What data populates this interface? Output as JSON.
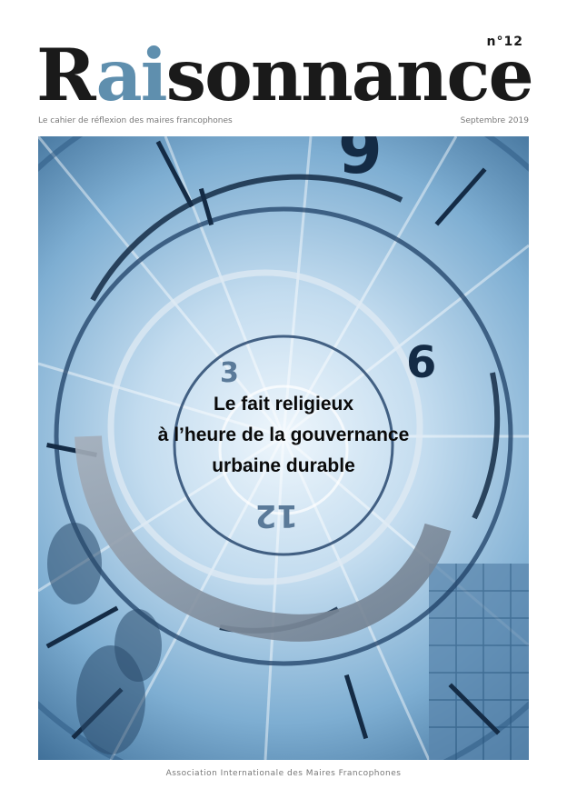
{
  "issue": {
    "label": "n°12"
  },
  "masthead": {
    "part1": "R",
    "accent": "ai",
    "part2": "sonnance"
  },
  "tagline": "Le cahier de réflexion des maires francophones",
  "date": "Septembre 2019",
  "headline": {
    "line1": "Le fait religieux",
    "line2": "à l’heure de la gouvernance",
    "line3": "urbaine durable"
  },
  "clock_numerals": [
    "9",
    "6",
    "3",
    "12"
  ],
  "footer": "Association Internationale des Maires Francophones",
  "colors": {
    "masthead_dark": "#1a1a1a",
    "masthead_accent": "#5f8fae",
    "cover_blue": "#7eaed2"
  }
}
